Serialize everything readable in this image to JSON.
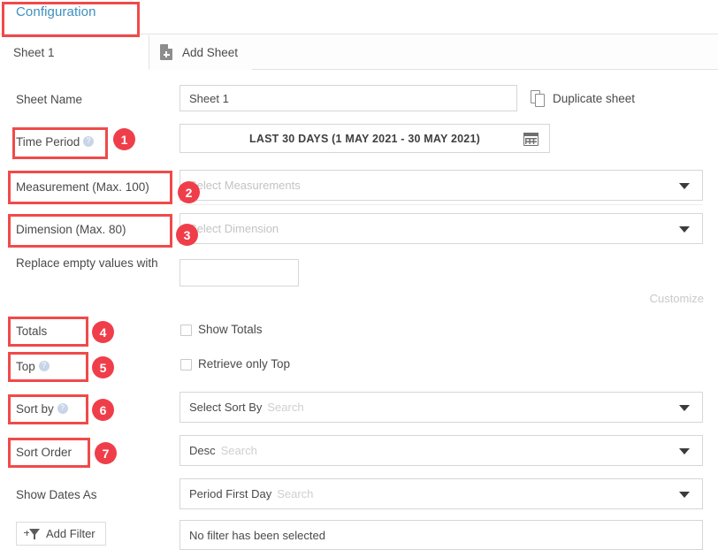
{
  "header": {
    "tab_label": "Configuration"
  },
  "sheet_tabs": {
    "active_tab": "Sheet 1",
    "add_sheet_label": "Add Sheet",
    "add_sheet_icon": "document-plus-icon"
  },
  "form": {
    "sheet_name": {
      "label": "Sheet Name",
      "value": "Sheet 1",
      "duplicate_label": "Duplicate sheet",
      "duplicate_icon": "duplicate-sheet-icon"
    },
    "time_period": {
      "label": "Time Period",
      "help_icon": "help-circle-icon",
      "value": "LAST 30 DAYS (1 MAY 2021 - 30 MAY 2021)",
      "calendar_icon": "calendar-icon"
    },
    "measurement": {
      "label": "Measurement (Max. 100)",
      "placeholder": "Select Measurements",
      "caret_icon": "chevron-down-icon"
    },
    "dimension": {
      "label": "Dimension (Max. 80)",
      "placeholder": "Select Dimension",
      "caret_icon": "chevron-down-icon"
    },
    "replace_empty": {
      "label": "Replace empty values with",
      "value": ""
    },
    "customize": {
      "label": "Customize"
    },
    "totals": {
      "label": "Totals",
      "checkbox_label": "Show Totals",
      "checked": false
    },
    "top": {
      "label": "Top",
      "help_icon": "help-circle-icon",
      "checkbox_label": "Retrieve only Top",
      "checked": false
    },
    "sort_by": {
      "label": "Sort by",
      "help_icon": "help-circle-icon",
      "value": "Select Sort By",
      "search_placeholder": "Search",
      "caret_icon": "chevron-down-icon"
    },
    "sort_order": {
      "label": "Sort Order",
      "value": "Desc",
      "search_placeholder": "Search",
      "caret_icon": "chevron-down-icon"
    },
    "show_dates_as": {
      "label": "Show Dates As",
      "value": "Period First Day",
      "search_placeholder": "Search",
      "caret_icon": "chevron-down-icon"
    },
    "filter": {
      "button_label": "Add Filter",
      "button_icon": "add-filter-funnel-icon",
      "status": "No filter has been selected"
    }
  },
  "annotations": {
    "badges": [
      "1",
      "2",
      "3",
      "4",
      "5",
      "6",
      "7"
    ],
    "box_color": "#f04a4a",
    "badge_color": "#ef3e4a"
  }
}
